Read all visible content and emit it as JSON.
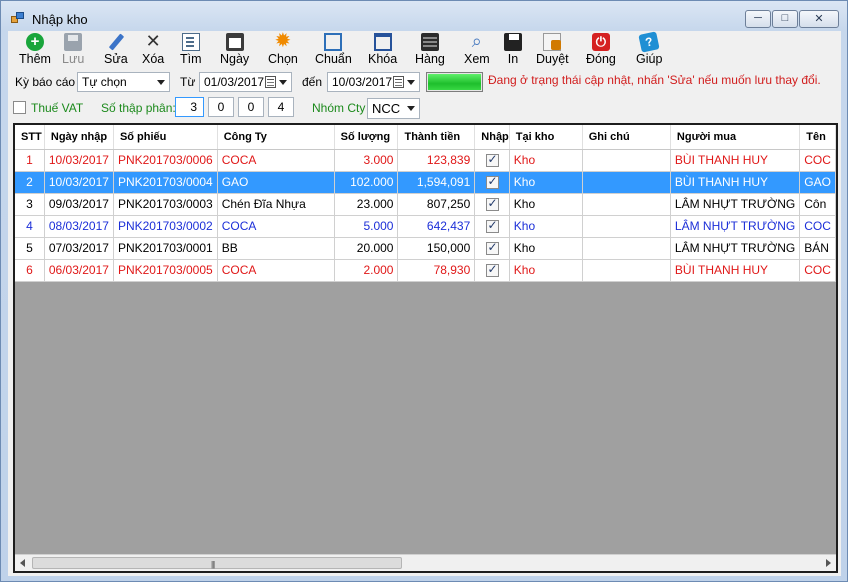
{
  "window": {
    "title": "Nhập kho",
    "minimize_glyph": "─",
    "maximize_glyph": "□",
    "close_glyph": "✕"
  },
  "toolbar": [
    {
      "key": "add",
      "label": "Thêm",
      "icon": "plus-circle-icon",
      "enabled": true
    },
    {
      "key": "save",
      "label": "Lưu",
      "icon": "save-icon",
      "enabled": false
    },
    {
      "key": "edit",
      "label": "Sửa",
      "icon": "pencil-icon",
      "enabled": true
    },
    {
      "key": "delete",
      "label": "Xóa",
      "icon": "delete-x-icon",
      "enabled": true
    },
    {
      "key": "find",
      "label": "Tìm",
      "icon": "find-document-icon",
      "enabled": true
    },
    {
      "key": "date",
      "label": "Ngày",
      "icon": "calendar-icon",
      "enabled": true
    },
    {
      "key": "choose",
      "label": "Chọn",
      "icon": "gear-icon",
      "enabled": true
    },
    {
      "key": "standard",
      "label": "Chuẩn",
      "icon": "select-frame-icon",
      "enabled": true
    },
    {
      "key": "lock",
      "label": "Khóa",
      "icon": "lock-icon",
      "enabled": true
    },
    {
      "key": "goods",
      "label": "Hàng",
      "icon": "goods-stack-icon",
      "enabled": true
    },
    {
      "key": "view",
      "label": "Xem",
      "icon": "view-icon",
      "enabled": true
    },
    {
      "key": "print",
      "label": "In",
      "icon": "printer-icon",
      "enabled": true
    },
    {
      "key": "approve",
      "label": "Duyệt",
      "icon": "approve-icon",
      "enabled": true
    },
    {
      "key": "close",
      "label": "Đóng",
      "icon": "power-icon",
      "enabled": true
    },
    {
      "key": "help",
      "label": "Giúp",
      "icon": "help-book-icon",
      "enabled": true
    }
  ],
  "filters": {
    "period_label": "Kỳ báo cáo",
    "period_value": "Tự chọn",
    "from_label": "Từ",
    "from_date": "01/03/2017",
    "to_label": "đến",
    "to_date": "10/03/2017",
    "progress_fraction": 1.0,
    "status_message": "Đang ở trạng thái cập nhật, nhấn 'Sửa' nếu muốn lưu thay đổi.",
    "vat_label": "Thuế VAT",
    "vat_checked": false,
    "decimals_label": "Số thập phân:",
    "decimals": [
      "3",
      "0",
      "0",
      "4"
    ],
    "company_group_label": "Nhóm Cty",
    "company_group_value": "NCC"
  },
  "grid": {
    "columns": [
      "STT",
      "Ngày nhập",
      "Số phiếu",
      "Công Ty",
      "Số lượng",
      "Thành tiền",
      "Nhập",
      "Tại kho",
      "Ghi chú",
      "Người mua",
      "Tên"
    ],
    "rows": [
      {
        "stt": "1",
        "date": "10/03/2017",
        "voucher": "PNK201703/0006",
        "company": "COCA",
        "qty": "3.000",
        "amount": "123,839",
        "imported": true,
        "warehouse": "Kho",
        "note": "",
        "buyer": "BÙI THANH HUY",
        "name": "COC",
        "color": "red",
        "selected": false
      },
      {
        "stt": "2",
        "date": "10/03/2017",
        "voucher": "PNK201703/0004",
        "company": "GAO",
        "qty": "102.000",
        "amount": "1,594,091",
        "imported": true,
        "warehouse": "Kho",
        "note": "",
        "buyer": "BÙI THANH HUY",
        "name": "GAO",
        "color": "black",
        "selected": true
      },
      {
        "stt": "3",
        "date": "09/03/2017",
        "voucher": "PNK201703/0003",
        "company": "Chén Đĩa Nhựa",
        "qty": "23.000",
        "amount": "807,250",
        "imported": true,
        "warehouse": "Kho",
        "note": "",
        "buyer": "LÂM NHỰT TRƯỜNG",
        "name": "Côn",
        "color": "black",
        "selected": false
      },
      {
        "stt": "4",
        "date": "08/03/2017",
        "voucher": "PNK201703/0002",
        "company": "COCA",
        "qty": "5.000",
        "amount": "642,437",
        "imported": true,
        "warehouse": "Kho",
        "note": "",
        "buyer": "LÂM NHỰT TRƯỜNG",
        "name": "COC",
        "color": "blue",
        "selected": false
      },
      {
        "stt": "5",
        "date": "07/03/2017",
        "voucher": "PNK201703/0001",
        "company": "BB",
        "qty": "20.000",
        "amount": "150,000",
        "imported": true,
        "warehouse": "Kho",
        "note": "",
        "buyer": "LÂM NHỰT TRƯỜNG",
        "name": "BÁN",
        "color": "black",
        "selected": false
      },
      {
        "stt": "6",
        "date": "06/03/2017",
        "voucher": "PNK201703/0005",
        "company": "COCA",
        "qty": "2.000",
        "amount": "78,930",
        "imported": true,
        "warehouse": "Kho",
        "note": "",
        "buyer": "BÙI THANH HUY",
        "name": "COC",
        "color": "red",
        "selected": false
      }
    ],
    "scroll_grip": "|||"
  }
}
